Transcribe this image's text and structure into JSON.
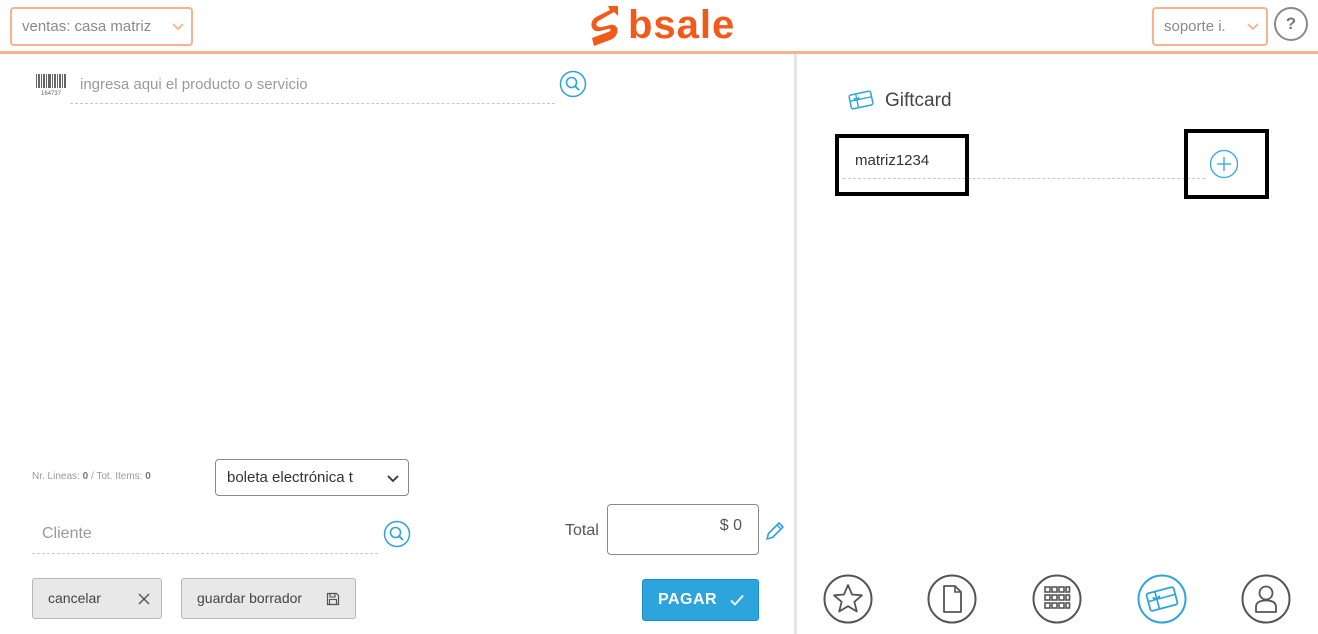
{
  "header": {
    "store_select_value": "ventas: casa matriz",
    "brand_name": "bsale",
    "user_select_value": "soporte i.",
    "help_label": "?"
  },
  "sale": {
    "product_search_placeholder": "ingresa aqui el producto o servicio",
    "barcode_number": "164737",
    "lines_label": "Nr. Lineas:",
    "lines_value": "0",
    "items_label": "/ Tot. Items:",
    "items_value": "0",
    "document_type_value": "boleta electrónica t",
    "client_placeholder": "Cliente",
    "total_label": "Total",
    "total_value": "$ 0",
    "cancel_label": "cancelar",
    "save_draft_label": "guardar borrador",
    "pay_label": "PAGAR"
  },
  "giftcard": {
    "title": "Giftcard",
    "code_value": "matriz1234"
  },
  "bottom_nav": [
    {
      "icon": "star-icon"
    },
    {
      "icon": "document-icon"
    },
    {
      "icon": "grid-icon"
    },
    {
      "icon": "giftcard-icon",
      "active": true
    },
    {
      "icon": "user-icon"
    }
  ],
  "colors": {
    "accent_orange": "#f05a1a",
    "border_orange": "#f8b28c",
    "accent_blue": "#2ea4dc",
    "muted_grey": "#8a8a8a"
  }
}
